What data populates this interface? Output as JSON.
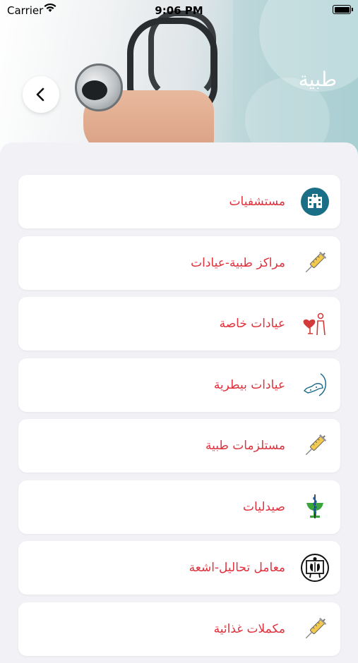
{
  "status_bar": {
    "carrier": "Carrier",
    "time": "9:06 PM"
  },
  "header": {
    "title": "طبية"
  },
  "items": [
    {
      "label": "مستشفيات",
      "icon": "hospital-icon"
    },
    {
      "label": "مراكز طبية-عيادات",
      "icon": "syringe-icon"
    },
    {
      "label": "عيادات خاصة",
      "icon": "heart-person-icon"
    },
    {
      "label": "عيادات بيطرية",
      "icon": "veterinary-icon"
    },
    {
      "label": "مستلزمات طبية",
      "icon": "syringe-icon"
    },
    {
      "label": "صيدليات",
      "icon": "pharmacy-icon"
    },
    {
      "label": "معامل تحاليل-اشعة",
      "icon": "xray-icon"
    },
    {
      "label": "مكملات غذائية",
      "icon": "syringe-icon"
    }
  ],
  "colors": {
    "accent": "#e0313c",
    "hospital": "#1a6f86",
    "pharmacy_green": "#3aa43c"
  }
}
